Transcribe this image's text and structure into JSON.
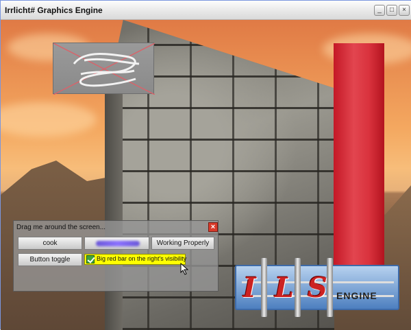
{
  "window": {
    "title": "Irrlicht# Graphics Engine",
    "minimize_icon": "minimize-icon",
    "maximize_icon": "maximize-icon",
    "close_icon": "close-icon"
  },
  "dialog": {
    "title": "Drag me around the screen...",
    "close_icon": "close-icon",
    "buttons": {
      "cook": "cook",
      "working": "Working Properly",
      "toggle": "Button toggle"
    },
    "checkbox": {
      "label": "Big red bar on the right's visibility",
      "checked": true
    }
  },
  "logo": {
    "letters": [
      "I",
      "L",
      "S"
    ],
    "word": "ENGINE"
  },
  "colors": {
    "red_bar": "#d9323d",
    "checkbox_highlight": "#ffff00",
    "dialog_close": "#d83a2a"
  }
}
